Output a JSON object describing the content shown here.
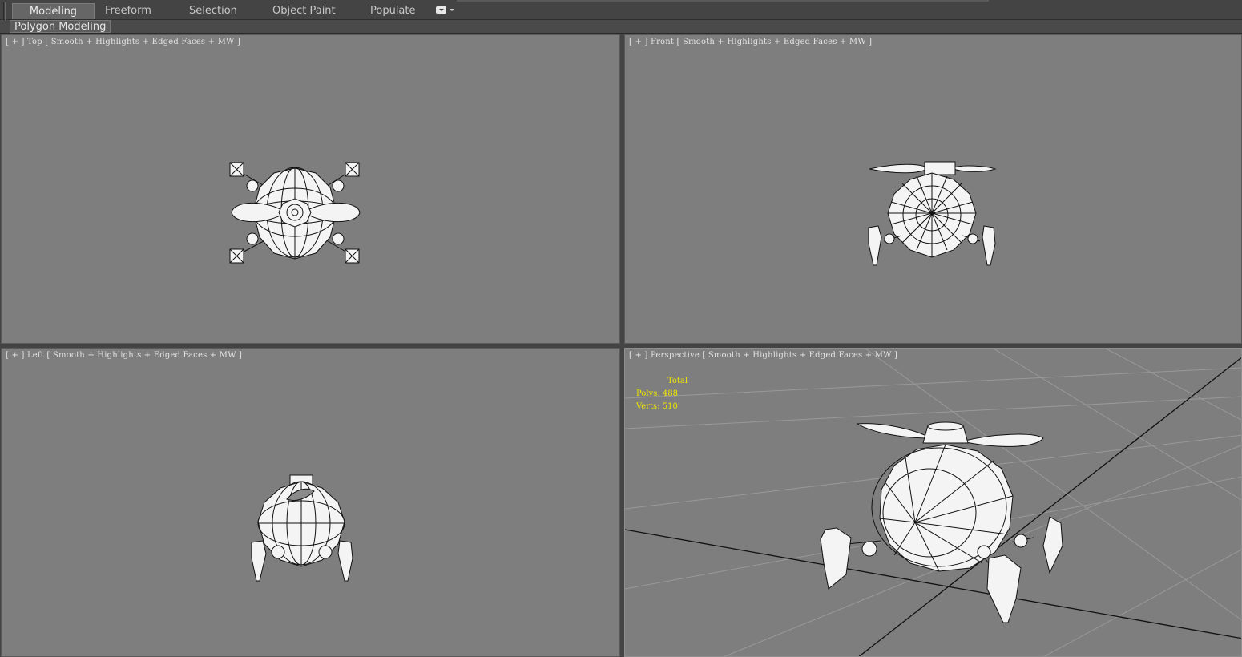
{
  "ribbon": {
    "tabs": [
      {
        "label": "Modeling",
        "active": true
      },
      {
        "label": "Freeform",
        "active": false
      },
      {
        "label": "Selection",
        "active": false
      },
      {
        "label": "Object Paint",
        "active": false
      },
      {
        "label": "Populate",
        "active": false
      }
    ],
    "panel_label": "Polygon Modeling"
  },
  "viewports": {
    "top": {
      "bracket_open": "[ + ]",
      "name": "Top",
      "shading": "[ Smooth + Highlights + Edged Faces + MW ]"
    },
    "front": {
      "bracket_open": "[ + ]",
      "name": "Front",
      "shading": "[ Smooth + Highlights + Edged Faces + MW ]"
    },
    "left": {
      "bracket_open": "[ + ]",
      "name": "Left",
      "shading": "[ Smooth + Highlights + Edged Faces + MW ]"
    },
    "perspective": {
      "bracket_open": "[ + ]",
      "name": "Perspective",
      "shading": "[ Smooth + Highlights + Edged Faces + MW ]"
    }
  },
  "stats": {
    "total_label": "Total",
    "polys_label": "Polys:",
    "polys_value": "488",
    "verts_label": "Verts:",
    "verts_value": "510"
  },
  "colors": {
    "viewport_bg": "#7e7e7e",
    "ui_bg": "#444444",
    "stats_text": "#f2e600",
    "active_tab": "#666666"
  }
}
